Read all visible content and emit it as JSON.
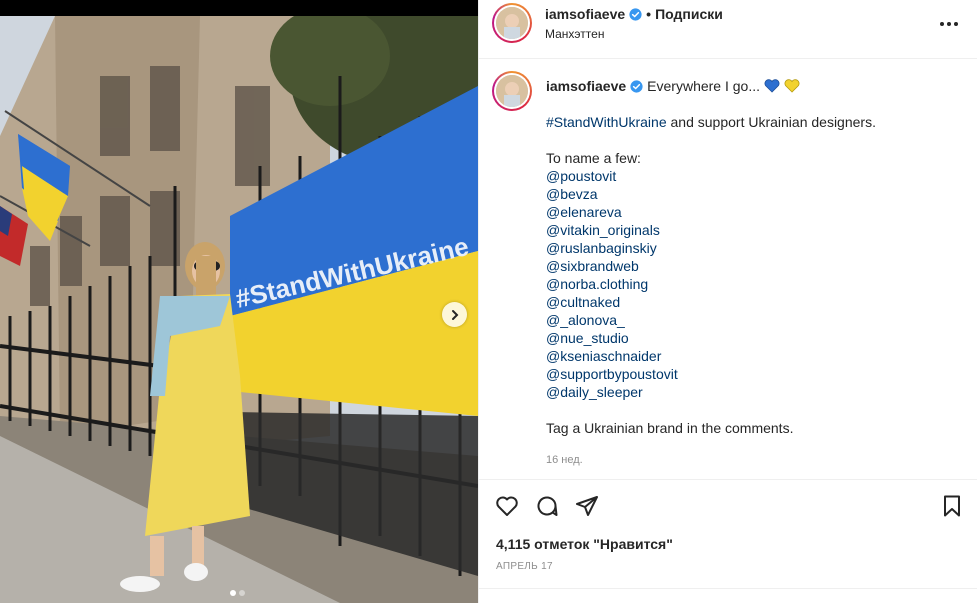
{
  "header": {
    "username": "iamsofiaeve",
    "separator": "•",
    "follow_label": "Подписки",
    "location": "Манхэттен"
  },
  "caption": {
    "username": "iamsofiaeve",
    "first_text": "Everywhere I go...",
    "hashtag": "#StandWithUkraine",
    "after_hashtag": " and support Ukrainian designers.",
    "intro": "To name a few:",
    "mentions": [
      "@poustovit",
      "@bevza",
      "@elenareva",
      "@vitakin_originals",
      "@ruslanbaginskiy",
      "@sixbrandweb",
      "@norba.clothing",
      "@cultnaked",
      "@_alonova_",
      "@nue_studio",
      "@kseniaschnaider",
      "@supportbypoustovit",
      "@daily_sleeper"
    ],
    "closing": "Tag a Ukrainian brand in the comments.",
    "time_ago": "16 нед."
  },
  "photo": {
    "banner_text": "#StandWithUkraine",
    "carousel_total": 2,
    "carousel_current": 1
  },
  "engagement": {
    "likes": "4,115 отметок \"Нравится\"",
    "date": "АПРЕЛЬ 17"
  },
  "icons": {
    "heart": "heart-icon",
    "comment": "comment-icon",
    "share": "share-icon",
    "save": "bookmark-icon",
    "more": "more-icon",
    "next": "chevron-right-icon",
    "verified": "verified-badge-icon"
  },
  "colors": {
    "link": "#00376b",
    "verified": "#3897f0",
    "muted": "#8e8e8e",
    "ukraine_blue": "#2d6fd0",
    "ukraine_yellow": "#f2d22e"
  }
}
